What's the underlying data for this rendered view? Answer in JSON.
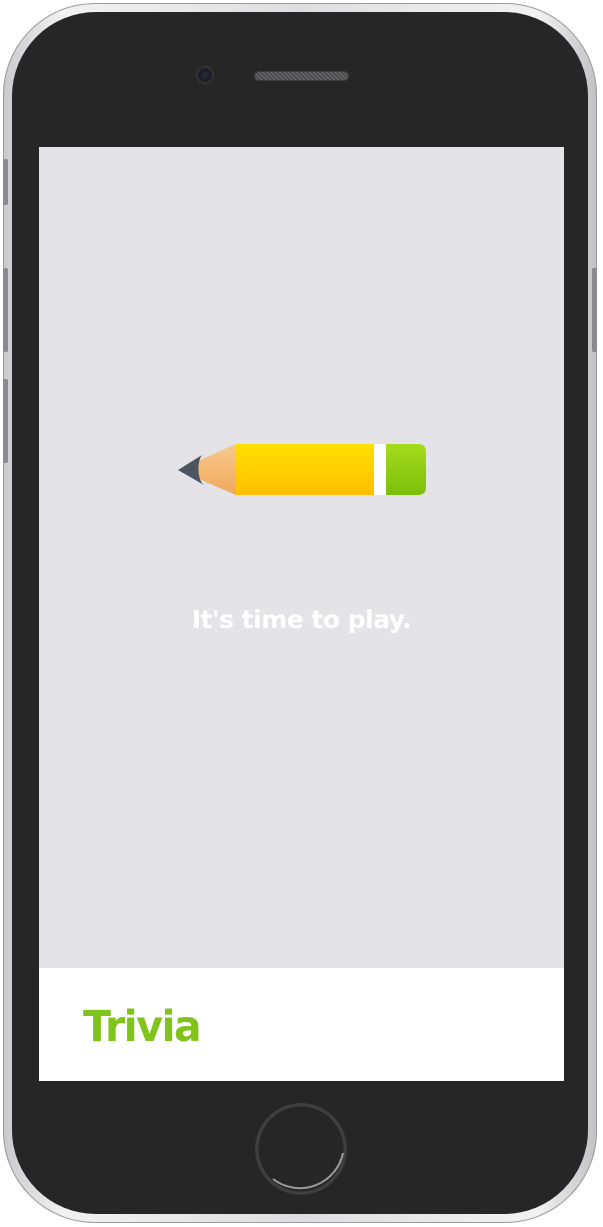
{
  "screen": {
    "tagline": "It's time to play."
  },
  "footer": {
    "brand": "Trivia"
  },
  "icons": {
    "hero": "pencil-icon"
  },
  "colors": {
    "screen_background": "#e4e4e8",
    "brand_green": "#7fc31c",
    "pencil_body": "#ffd400",
    "pencil_eraser": "#8ccc12",
    "phone_body": "#262626"
  }
}
